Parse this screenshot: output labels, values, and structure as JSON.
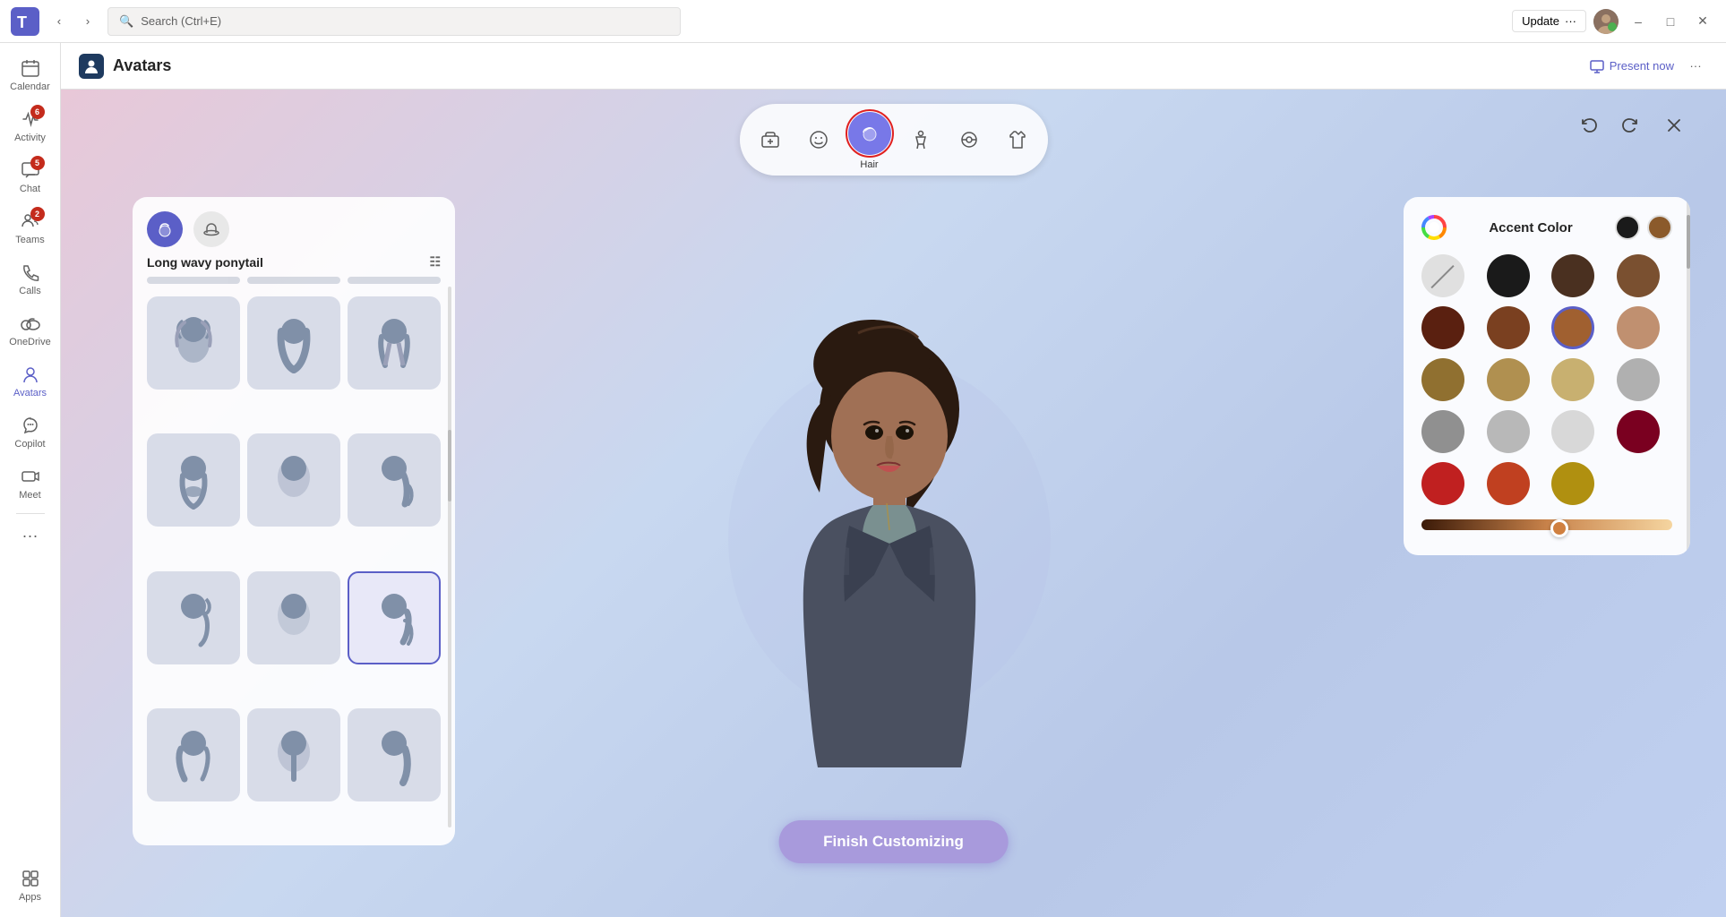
{
  "titlebar": {
    "app_name": "Microsoft Teams",
    "search_placeholder": "Search (Ctrl+E)",
    "update_label": "Update",
    "update_dots": "···",
    "minimize_label": "–",
    "maximize_label": "□",
    "close_label": "✕"
  },
  "sidebar": {
    "items": [
      {
        "id": "calendar",
        "label": "Calendar",
        "badge": null,
        "active": false
      },
      {
        "id": "activity",
        "label": "Activity",
        "badge": "6",
        "active": false
      },
      {
        "id": "chat",
        "label": "Chat",
        "badge": "5",
        "active": false
      },
      {
        "id": "teams",
        "label": "Teams",
        "badge": "2",
        "active": false
      },
      {
        "id": "calls",
        "label": "Calls",
        "badge": null,
        "active": false
      },
      {
        "id": "onedrive",
        "label": "OneDrive",
        "badge": null,
        "active": false
      },
      {
        "id": "avatars",
        "label": "Avatars",
        "badge": null,
        "active": true
      },
      {
        "id": "copilot",
        "label": "Copilot",
        "badge": null,
        "active": false
      },
      {
        "id": "meet",
        "label": "Meet",
        "badge": null,
        "active": false
      }
    ],
    "more_label": "···",
    "apps_label": "Apps"
  },
  "page_header": {
    "title": "Avatars",
    "present_now_label": "Present now",
    "more_label": "···"
  },
  "category_tabs": [
    {
      "id": "scene",
      "label": "",
      "active": false
    },
    {
      "id": "face",
      "label": "",
      "active": false
    },
    {
      "id": "hair",
      "label": "Hair",
      "active": true
    },
    {
      "id": "body",
      "label": "",
      "active": false
    },
    {
      "id": "accessories",
      "label": "",
      "active": false
    },
    {
      "id": "outfit",
      "label": "",
      "active": false
    }
  ],
  "hair_panel": {
    "current_style": "Long wavy ponytail",
    "tabs": [
      {
        "id": "hair",
        "active": true
      },
      {
        "id": "hat",
        "active": false
      }
    ],
    "items": [
      {
        "id": 1,
        "selected": false
      },
      {
        "id": 2,
        "selected": false
      },
      {
        "id": 3,
        "selected": false
      },
      {
        "id": 4,
        "selected": false
      },
      {
        "id": 5,
        "selected": false
      },
      {
        "id": 6,
        "selected": false
      },
      {
        "id": 7,
        "selected": false
      },
      {
        "id": 8,
        "selected": false
      },
      {
        "id": 9,
        "selected": true
      },
      {
        "id": 10,
        "selected": false
      },
      {
        "id": 11,
        "selected": false
      },
      {
        "id": 12,
        "selected": false
      }
    ]
  },
  "color_panel": {
    "title": "Accent Color",
    "selected_color_1": "#1a1a1a",
    "selected_color_2": "#8B5a2b",
    "colors": [
      {
        "id": "none",
        "hex": null,
        "label": "None"
      },
      {
        "id": "black",
        "hex": "#1a1a1a",
        "label": "Black"
      },
      {
        "id": "dark-brown",
        "hex": "#4a3020",
        "label": "Dark Brown"
      },
      {
        "id": "medium-brown",
        "hex": "#7a5030",
        "label": "Medium Brown"
      },
      {
        "id": "brown1",
        "hex": "#5a2010",
        "label": "Dark Auburn"
      },
      {
        "id": "brown2",
        "hex": "#7a4020",
        "label": "Auburn"
      },
      {
        "id": "brown3",
        "hex": "#a06030",
        "label": "Light Auburn",
        "selected": true
      },
      {
        "id": "brown4",
        "hex": "#c09070",
        "label": "Sandy Brown"
      },
      {
        "id": "gold1",
        "hex": "#907030",
        "label": "Dark Gold"
      },
      {
        "id": "gold2",
        "hex": "#b09050",
        "label": "Gold"
      },
      {
        "id": "blonde1",
        "hex": "#c8b070",
        "label": "Dark Blonde"
      },
      {
        "id": "grey1",
        "hex": "#b0b0b0",
        "label": "Light Grey"
      },
      {
        "id": "grey2",
        "hex": "#909090",
        "label": "Medium Grey"
      },
      {
        "id": "grey3",
        "hex": "#b8b8b8",
        "label": "Grey"
      },
      {
        "id": "grey4",
        "hex": "#d8d8d8",
        "label": "Light Grey 2"
      },
      {
        "id": "red1",
        "hex": "#7a0020",
        "label": "Dark Red"
      },
      {
        "id": "red2",
        "hex": "#c02020",
        "label": "Red"
      },
      {
        "id": "red3",
        "hex": "#c04020",
        "label": "Red-Orange"
      },
      {
        "id": "gold3",
        "hex": "#b09010",
        "label": "Dark Yellow"
      }
    ],
    "slider_value": 55
  },
  "editor_controls": {
    "undo_label": "Undo",
    "redo_label": "Redo",
    "close_label": "Close"
  },
  "finish_button": {
    "label": "Finish Customizing"
  }
}
